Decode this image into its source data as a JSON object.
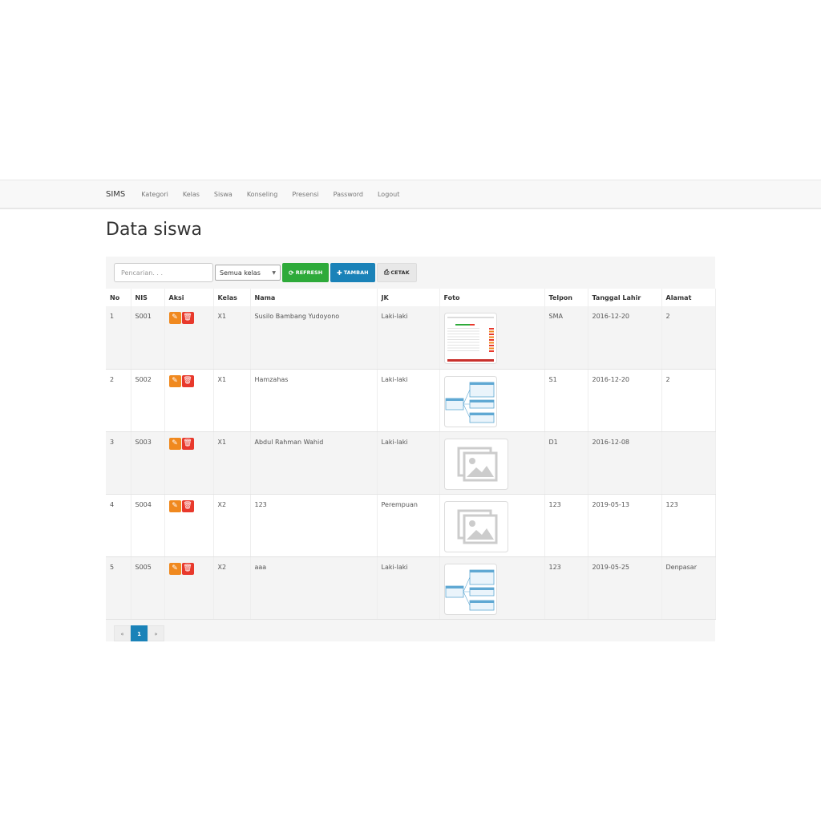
{
  "nav": {
    "brand": "SIMS",
    "items": [
      "Kategori",
      "Kelas",
      "Siswa",
      "Konseling",
      "Presensi",
      "Password",
      "Logout"
    ]
  },
  "page": {
    "title": "Data siswa"
  },
  "toolbar": {
    "search_placeholder": "Pencarian. . .",
    "class_filter": "Semua kelas",
    "refresh_label": "REFRESH",
    "add_label": "TAMBAH",
    "print_label": "CETAK"
  },
  "table": {
    "headers": [
      "No",
      "NIS",
      "Aksi",
      "Kelas",
      "Nama",
      "JK",
      "Foto",
      "Telpon",
      "Tanggal Lahir",
      "Alamat"
    ],
    "rows": [
      {
        "no": "1",
        "nis": "S001",
        "kelas": "X1",
        "nama": "Susilo Bambang Yudoyono",
        "jk": "Laki-laki",
        "foto": "screenshot-table",
        "telpon": "SMA",
        "tanggal_lahir": "2016-12-20",
        "alamat": "2"
      },
      {
        "no": "2",
        "nis": "S002",
        "kelas": "X1",
        "nama": "Hamzahas",
        "jk": "Laki-laki",
        "foto": "diagram",
        "telpon": "S1",
        "tanggal_lahir": "2016-12-20",
        "alamat": "2"
      },
      {
        "no": "3",
        "nis": "S003",
        "kelas": "X1",
        "nama": "Abdul Rahman Wahid",
        "jk": "Laki-laki",
        "foto": "placeholder",
        "telpon": "D1",
        "tanggal_lahir": "2016-12-08",
        "alamat": ""
      },
      {
        "no": "4",
        "nis": "S004",
        "kelas": "X2",
        "nama": "123",
        "jk": "Perempuan",
        "foto": "placeholder",
        "telpon": "123",
        "tanggal_lahir": "2019-05-13",
        "alamat": "123"
      },
      {
        "no": "5",
        "nis": "S005",
        "kelas": "X2",
        "nama": "aaa",
        "jk": "Laki-laki",
        "foto": "diagram",
        "telpon": "123",
        "tanggal_lahir": "2019-05-25",
        "alamat": "Denpasar"
      }
    ]
  },
  "pagination": {
    "prev": "«",
    "current": "1",
    "next": "»"
  },
  "colors": {
    "refresh": "#2eaa3a",
    "add": "#1a82b8",
    "edit": "#f0891f",
    "delete": "#e8392c",
    "active_page": "#1a82b8"
  }
}
